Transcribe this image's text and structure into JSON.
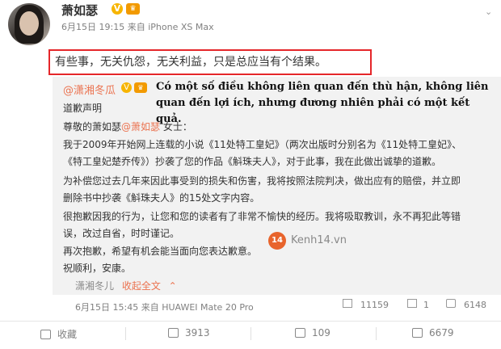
{
  "post": {
    "username": "萧如瑟",
    "v_badge": "V",
    "time": "6月15日 19:15",
    "via_prefix": "来自",
    "device": "iPhone XS Max",
    "text": "有些事，无关仇怨，无关利益，只是总应当有个结果。"
  },
  "quoted": {
    "author": "@潇湘冬瓜",
    "overlay_vi": "Có một số điều không liên quan đến thù hận, không liên quan đến lợi ích, nhưng đương nhiên phải có một kết quả.",
    "lines": [
      "道歉声明",
      "尊敬的萧如瑟@萧如瑟 女士：",
      "我于2009年开始网上连载的小说《11处特工皇妃》（两次出版时分别名为《11处特工皇妃》、",
      "《特工皇妃楚乔传》）抄袭了您的作品《斛珠夫人》，对于此事，我在此做出诚挚的道歉。",
      "为补偿您过去几年来因此事受到的损失和伤害，我将按照法院判决，做出应有的赔偿，并立即",
      "删除书中抄袭《斛珠夫人》的15处文字内容。",
      "很抱歉因我的行为，让您和您的读者有了非常不愉快的经历。我将吸取教训，永不再犯此等错",
      "误，改过自省，时时谨记。",
      "再次抱歉，希望有机会能当面向您表达歉意。",
      "祝顺利，安康。"
    ],
    "mention": "@萧如瑟",
    "footer_name": "潇湘冬儿",
    "collapse": "收起全文",
    "time": "6月15日 15:45",
    "via_prefix": "来自",
    "device": "HUAWEI Mate 20 Pro",
    "reposts": "11159",
    "comments": "1",
    "likes": "6148"
  },
  "watermark": {
    "logo": "14",
    "text": "Kenh14.vn"
  },
  "actions": {
    "favorite": "收藏",
    "reposts": "3913",
    "comments": "109",
    "likes": "6679"
  },
  "colors": {
    "accent": "#eb7350",
    "highlight": "#e5262a",
    "quote_bg": "#f2f2f2"
  }
}
